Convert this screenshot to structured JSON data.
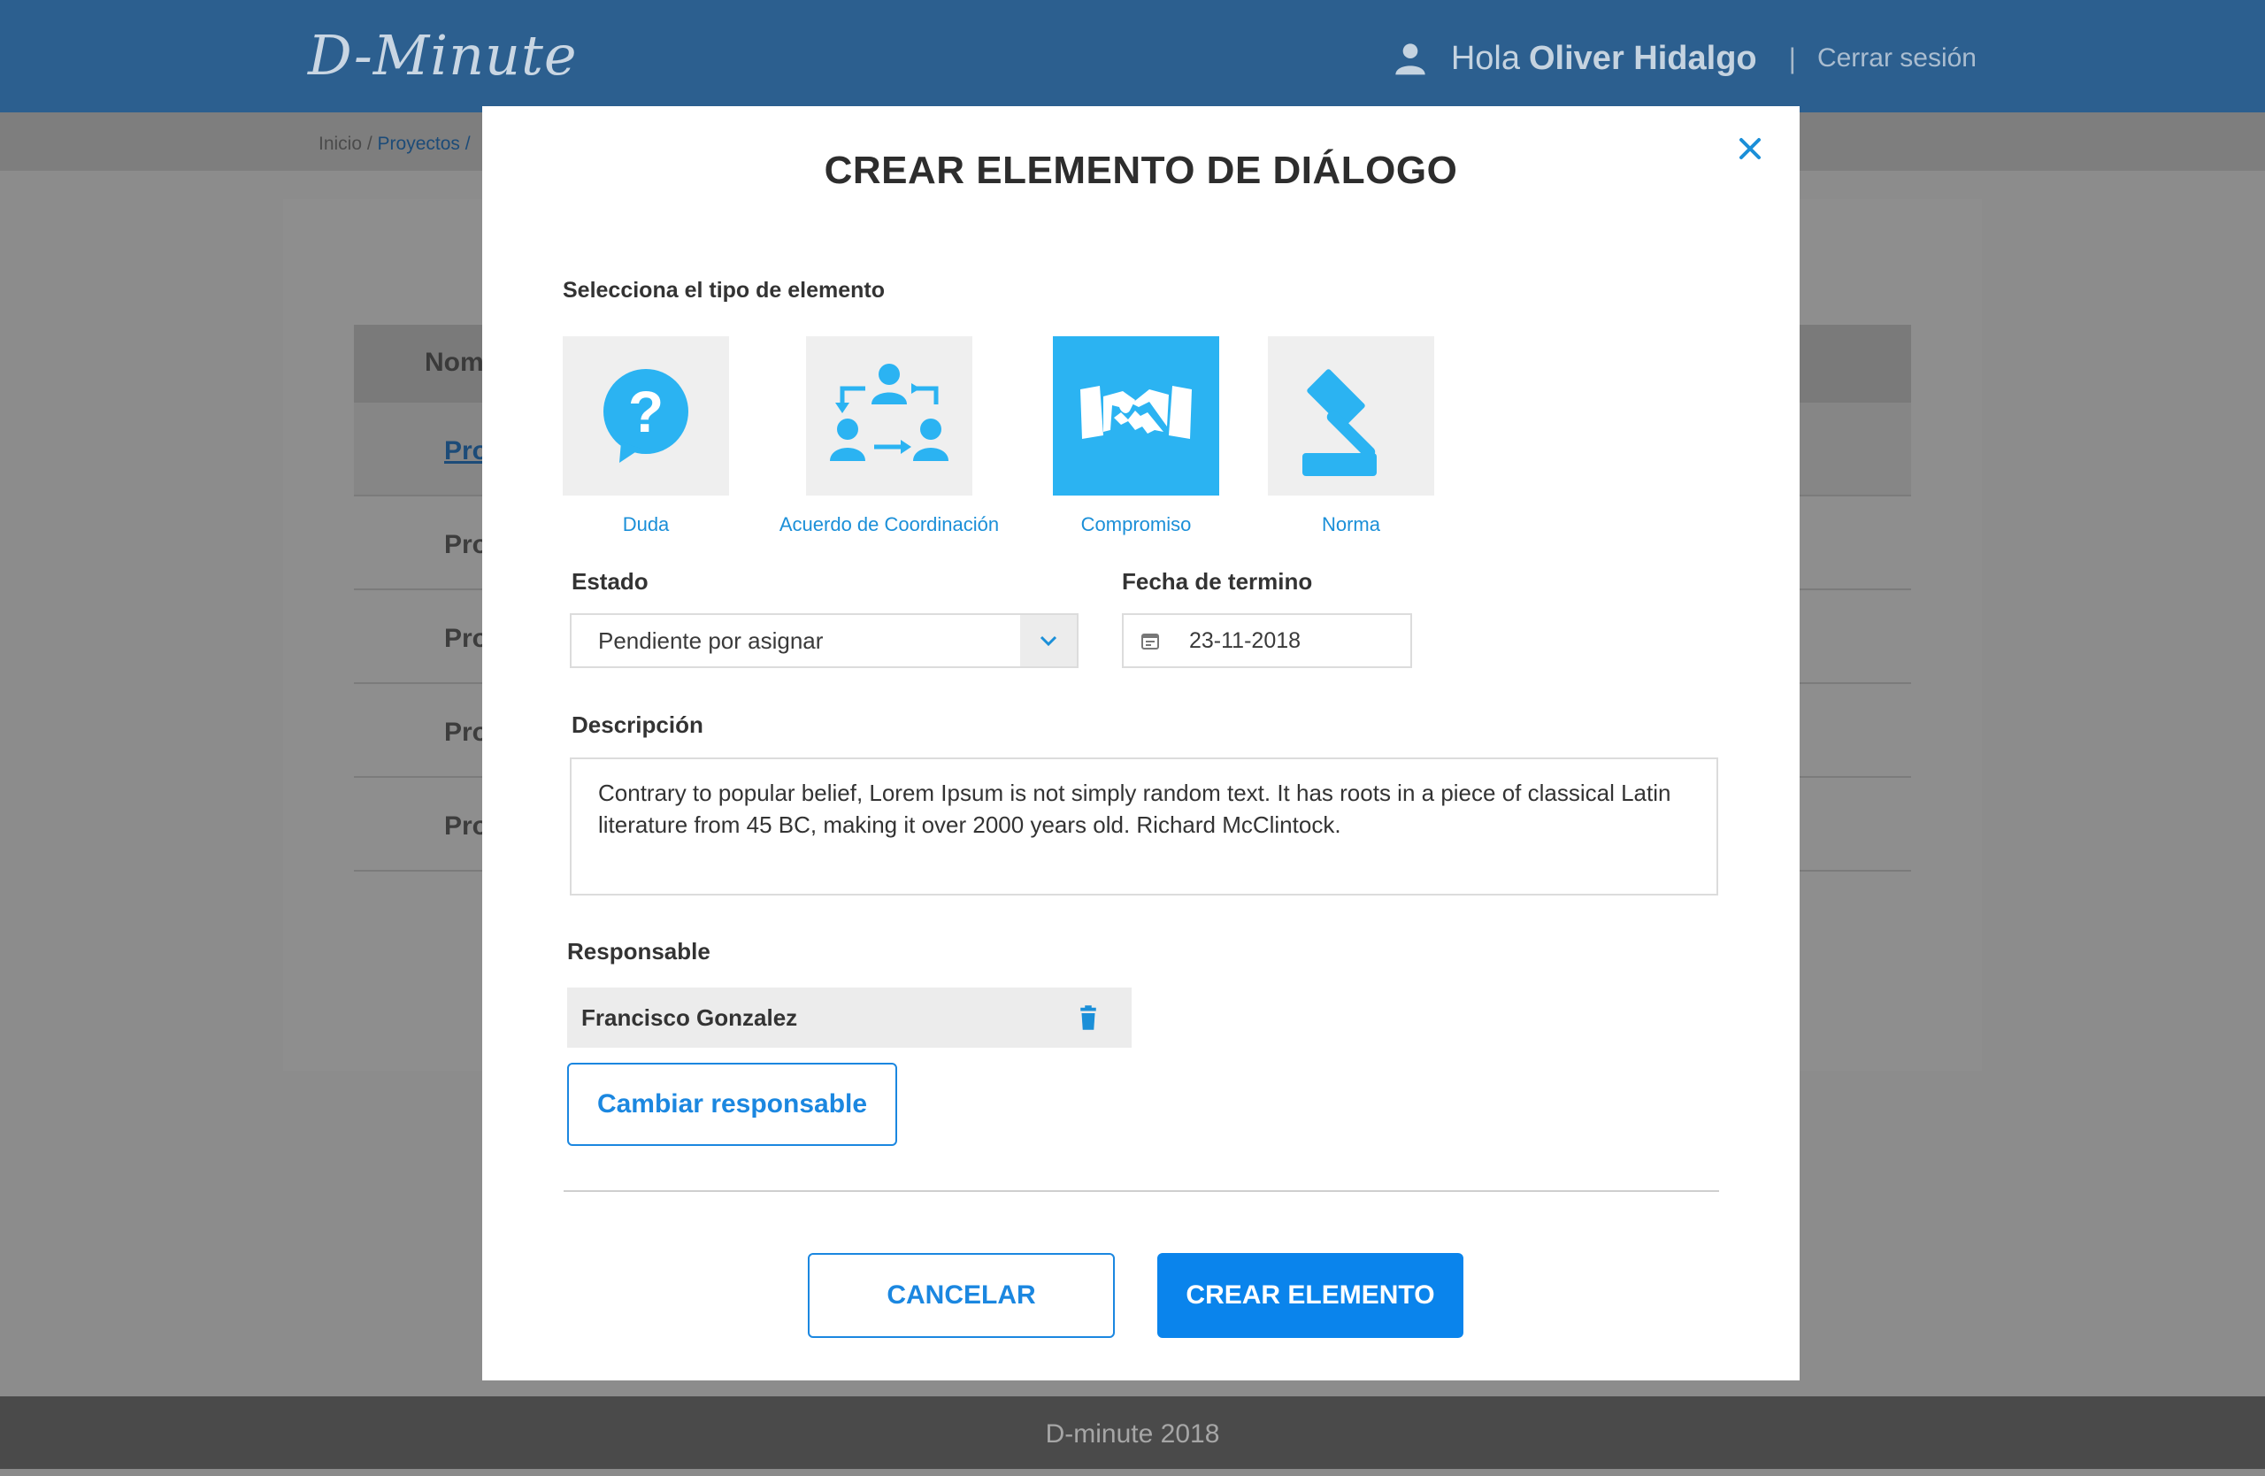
{
  "app": {
    "logo": "D-Minute",
    "greeting": "Hola",
    "user_name": "Oliver Hidalgo",
    "separator": "|",
    "logout": "Cerrar sesión"
  },
  "breadcrumb": {
    "home": "Inicio",
    "sep": " / ",
    "projects": "Proyectos /"
  },
  "background_table": {
    "header": "Nom",
    "rows": [
      "Pro",
      "Pro",
      "Pro",
      "Pro",
      "Pro"
    ]
  },
  "footer": {
    "text": "D-minute 2018"
  },
  "modal": {
    "title": "CREAR ELEMENTO DE DIÁLOGO",
    "type_label": "Selecciona el tipo de elemento",
    "types": [
      {
        "label": "Duda",
        "icon": "question-bubble-icon",
        "selected": false
      },
      {
        "label": "Acuerdo de Coordinación",
        "icon": "coordination-people-icon",
        "selected": false
      },
      {
        "label": "Compromiso",
        "icon": "handshake-icon",
        "selected": true
      },
      {
        "label": "Norma",
        "icon": "gavel-icon",
        "selected": false
      }
    ],
    "estado": {
      "label": "Estado",
      "value": "Pendiente por asignar"
    },
    "fecha": {
      "label": "Fecha de termino",
      "value": "23-11-2018"
    },
    "descripcion": {
      "label": "Descripción",
      "value": "Contrary to popular belief, Lorem Ipsum is not simply random text. It has roots in a piece of classical Latin literature from 45 BC, making it over 2000 years old. Richard McClintock."
    },
    "responsable": {
      "label": "Responsable",
      "name": "Francisco Gonzalez",
      "change_button": "Cambiar responsable"
    },
    "cancel_button": "CANCELAR",
    "create_button": "CREAR ELEMENTO"
  },
  "colors": {
    "header_bg": "#2c5f8f",
    "accent": "#2bb3f2",
    "primary_button": "#0a84ec",
    "link": "#1b8fd8"
  }
}
